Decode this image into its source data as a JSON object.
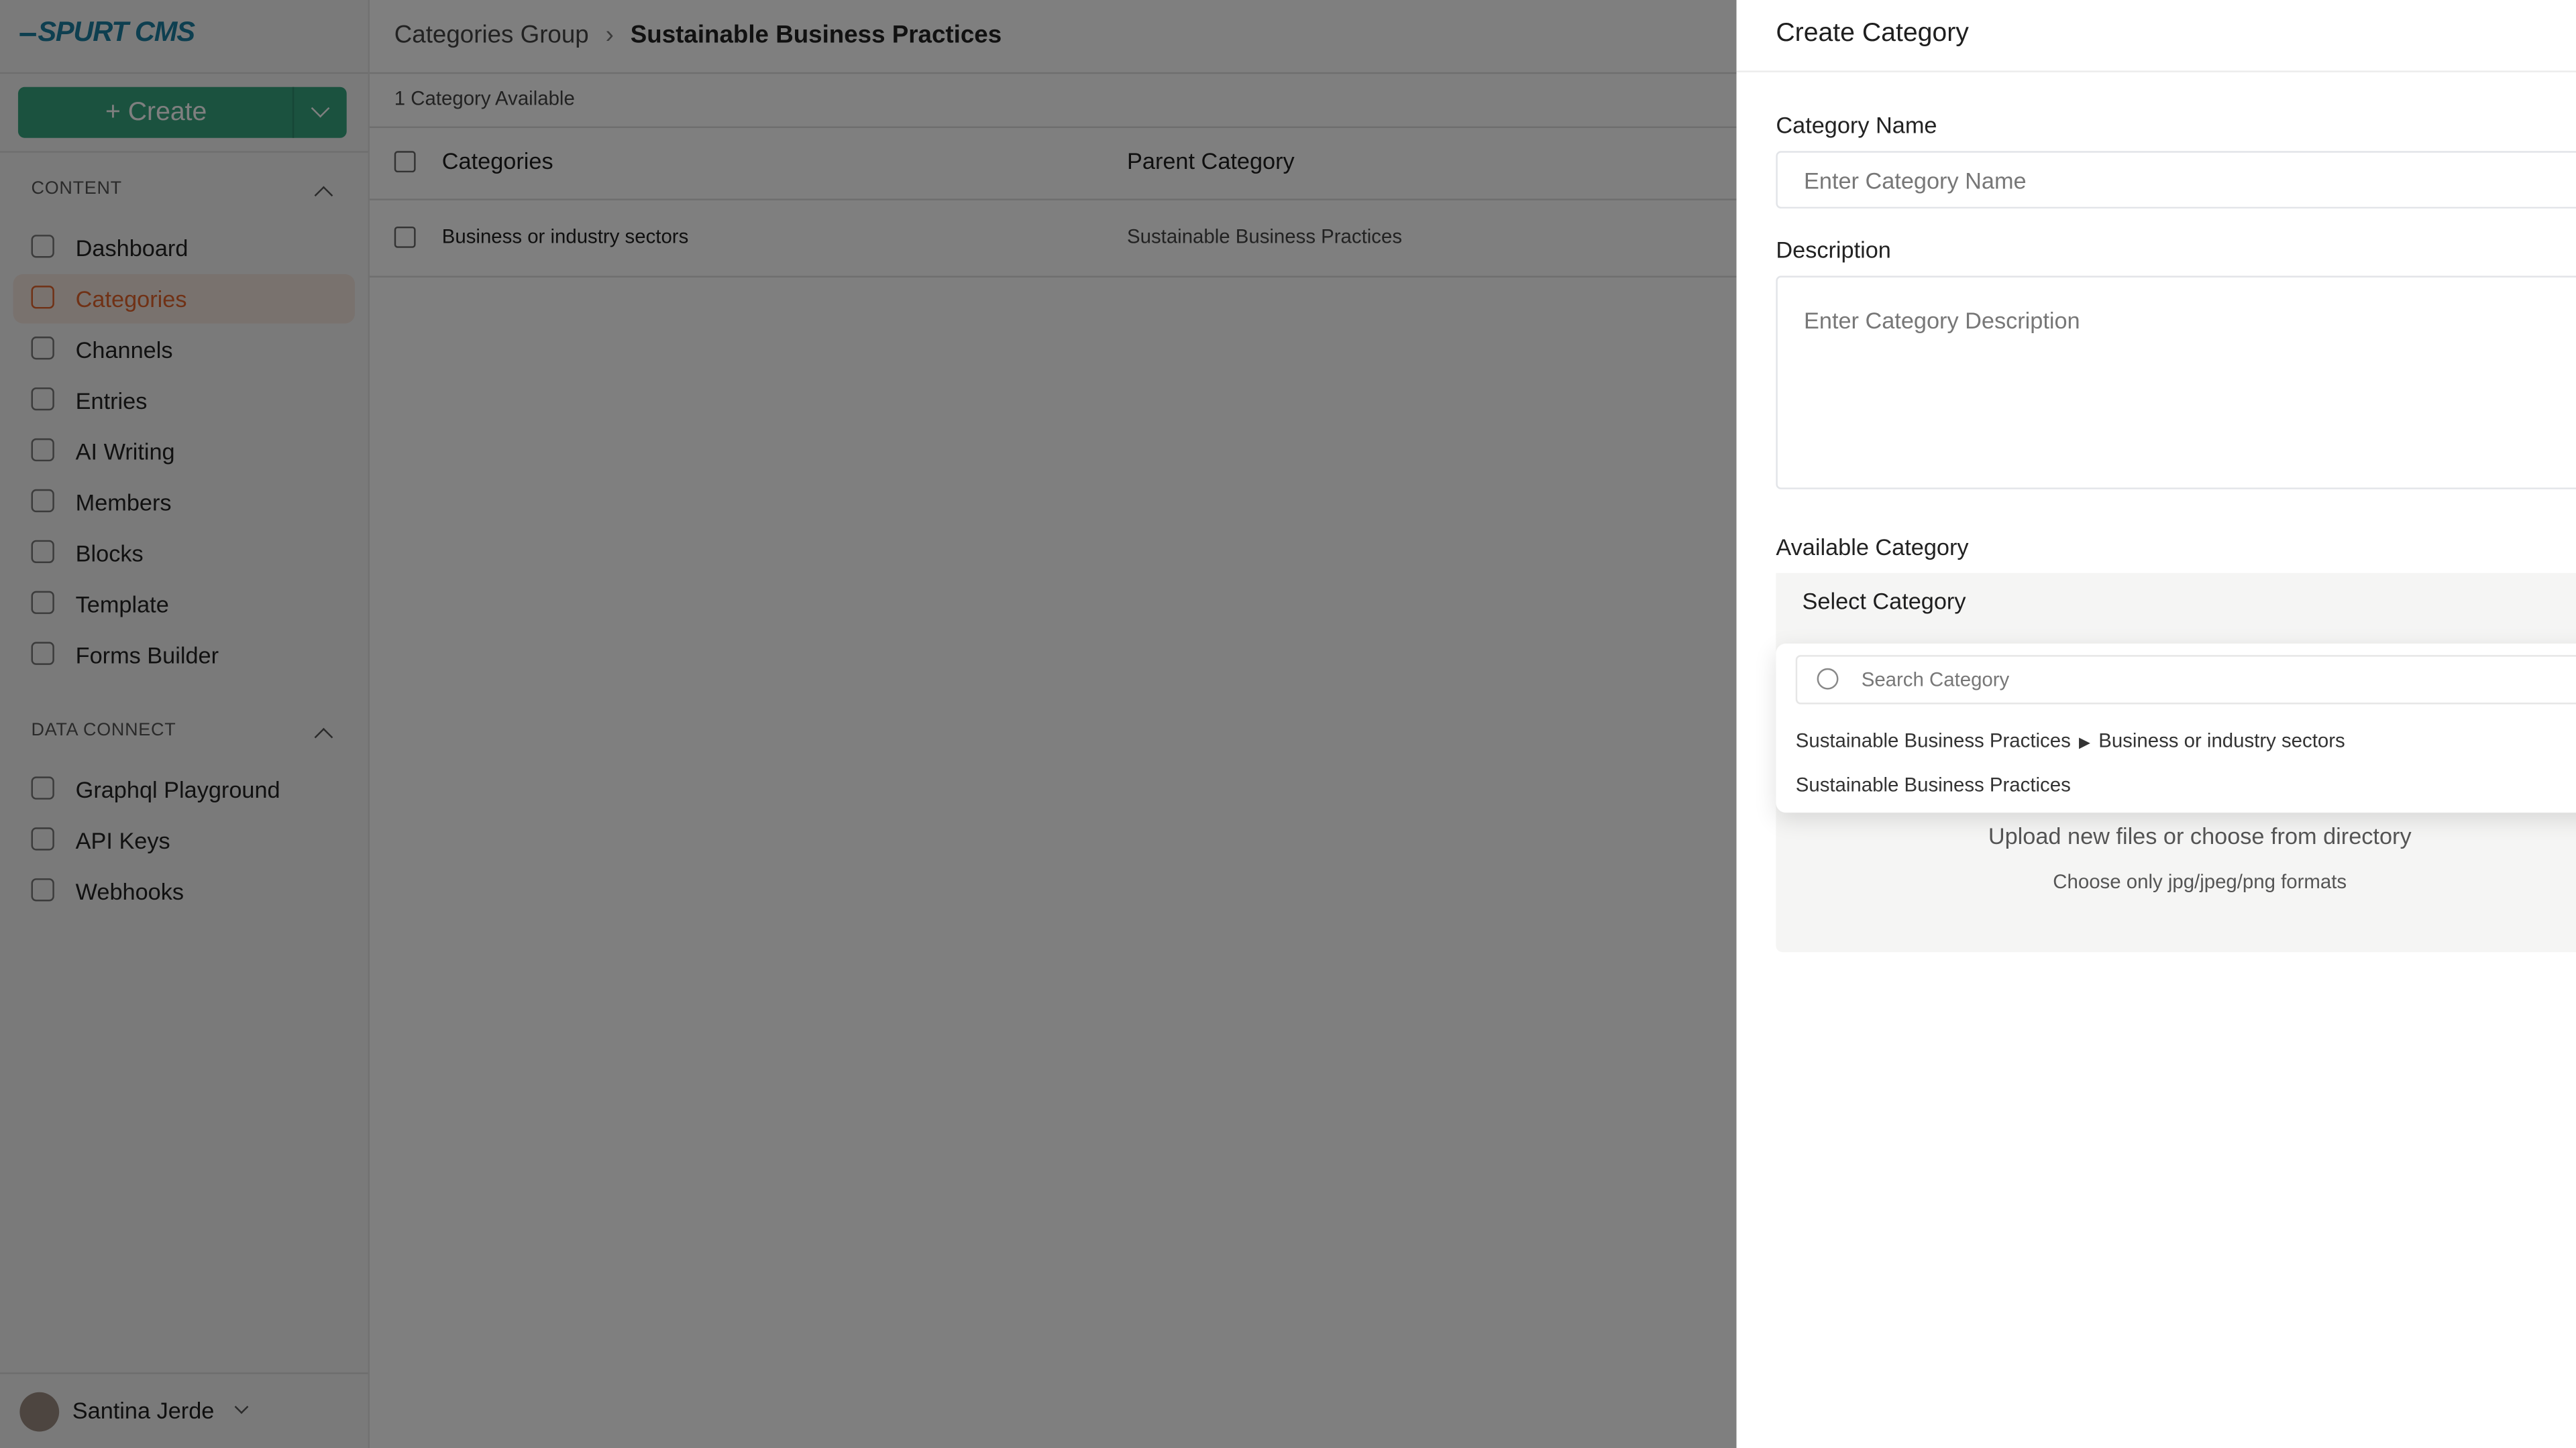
{
  "app": {
    "logo": "SPURT CMS"
  },
  "sidebar": {
    "create_label": "+ Create",
    "content_heading": "CONTENT",
    "content_items": [
      {
        "label": "Dashboard",
        "icon": "dashboard-icon"
      },
      {
        "label": "Categories",
        "icon": "layers-icon",
        "active": true
      },
      {
        "label": "Channels",
        "icon": "channels-icon"
      },
      {
        "label": "Entries",
        "icon": "entries-icon"
      },
      {
        "label": "AI Writing",
        "icon": "ai-writing-icon"
      },
      {
        "label": "Members",
        "icon": "members-icon"
      },
      {
        "label": "Blocks",
        "icon": "blocks-icon"
      },
      {
        "label": "Template",
        "icon": "template-icon"
      },
      {
        "label": "Forms Builder",
        "icon": "forms-icon"
      }
    ],
    "data_heading": "DATA CONNECT",
    "data_items": [
      {
        "label": "Graphql Playground",
        "icon": "graphql-icon"
      },
      {
        "label": "API Keys",
        "icon": "key-icon"
      },
      {
        "label": "Webhooks",
        "icon": "webhook-icon"
      }
    ],
    "user": "Santina Jerde"
  },
  "main": {
    "breadcrumb": [
      "Categories Group",
      "Sustainable Business Practices"
    ],
    "count": "1 Category Available",
    "columns": [
      "Categories",
      "Parent Category"
    ],
    "rows": [
      {
        "name": "Business or industry sectors",
        "parent": "Sustainable Business Practices"
      }
    ]
  },
  "panel": {
    "title": "Create Category",
    "name_label": "Category Name",
    "name_placeholder": "Enter Category Name",
    "desc_label": "Description",
    "desc_placeholder": "Enter Category Description",
    "avail_label": "Available Category",
    "select_value": "Select Category",
    "search_placeholder": "Search Category",
    "options": [
      {
        "path": [
          "Sustainable Business Practices",
          "Business or industry sectors"
        ]
      },
      {
        "path": [
          "Sustainable Business Practices"
        ]
      }
    ],
    "upload_text": "Upload new files or choose from directory",
    "upload_hint": "Choose only jpg/jpeg/png formats"
  },
  "colors": {
    "accent": "#e0622a",
    "create": "#37a47f",
    "logo": "#1d7fa0"
  }
}
